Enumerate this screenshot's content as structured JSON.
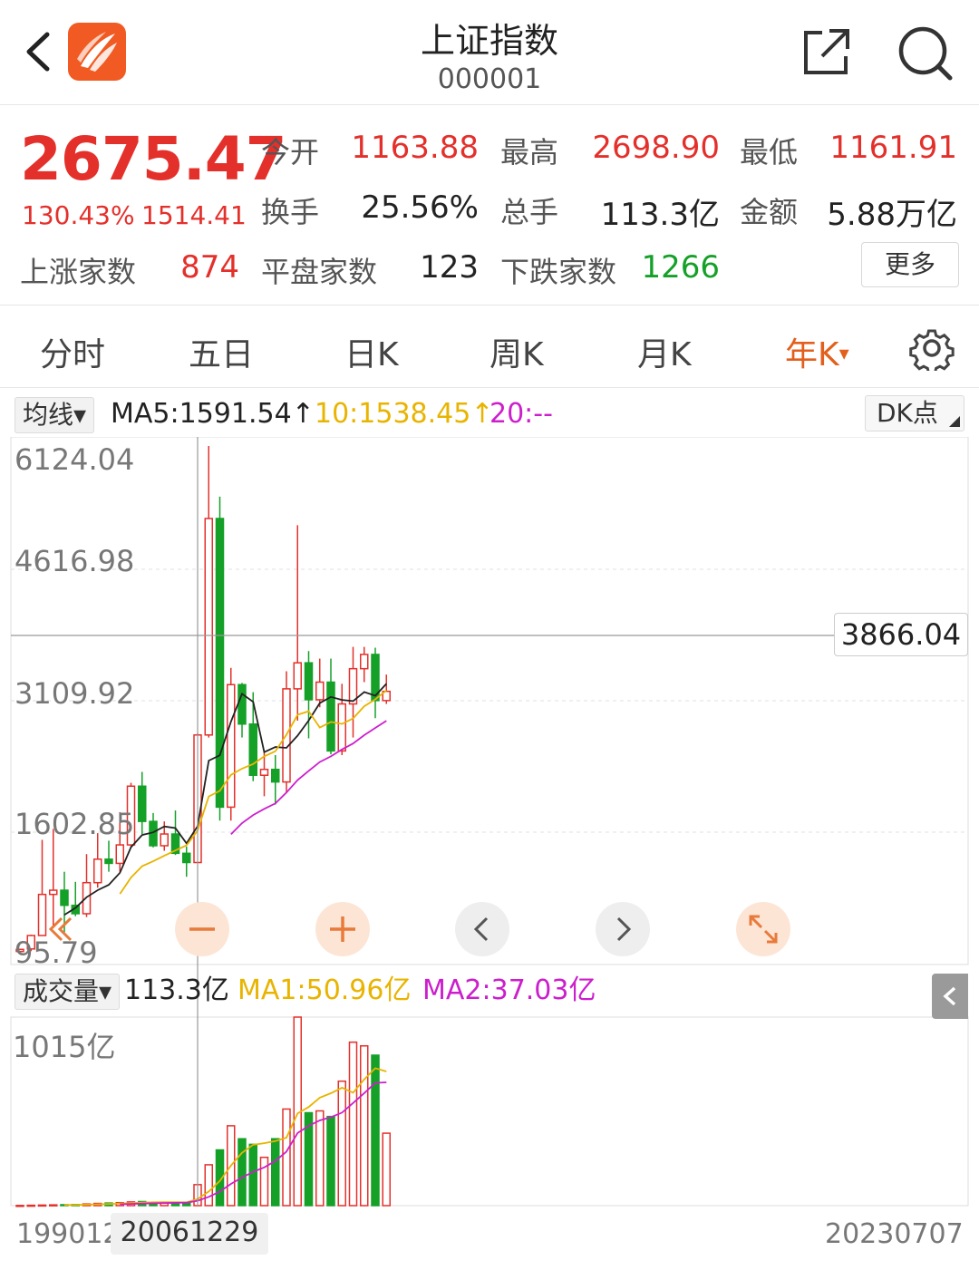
{
  "header": {
    "title": "上证指数",
    "code": "000001"
  },
  "quote": {
    "price": "2675.47",
    "pct": "130.43%",
    "chg": "1514.41",
    "open_label": "今开",
    "open": "1163.88",
    "high_label": "最高",
    "high": "2698.90",
    "low_label": "最低",
    "low": "1161.91",
    "turnover_label": "换手",
    "turnover": "25.56%",
    "volume_label": "总手",
    "volume": "113.3亿",
    "amount_label": "金额",
    "amount": "5.88万亿",
    "up_label": "上涨家数",
    "up": "874",
    "flat_label": "平盘家数",
    "flat": "123",
    "down_label": "下跌家数",
    "down": "1266",
    "more": "更多"
  },
  "tabs": [
    {
      "label": "分时"
    },
    {
      "label": "五日"
    },
    {
      "label": "日K"
    },
    {
      "label": "周K"
    },
    {
      "label": "月K"
    },
    {
      "label": "年K"
    }
  ],
  "active_tab_suffix": "▾",
  "ma": {
    "dropdown": "均线▾",
    "ma5": "MA5:1591.54↑",
    "ma10": "10:1538.45↑",
    "ma20": "20:--",
    "dk": "DK点"
  },
  "volume": {
    "dropdown": "成交量▾",
    "total": "113.3亿",
    "ma1": "MA1:50.96亿",
    "ma2": "MA2:37.03亿"
  },
  "colors": {
    "up": "#e4302b",
    "down": "#15a028",
    "ma5": "#222222",
    "ma10": "#e8b400",
    "ma20": "#cc1fcc",
    "accent": "#e35f1c"
  },
  "chart_data": {
    "type": "candlestick",
    "period": "yearly",
    "price_axis": {
      "ticks": [
        "6124.04",
        "4616.98",
        "3109.92",
        "1602.85",
        "95.79"
      ],
      "range": [
        95.79,
        6124.04
      ]
    },
    "crosshair_price": "3866.04",
    "volume_axis": {
      "max_label": "1015亿"
    },
    "x_labels": {
      "start": "199012",
      "cursor": "20061229",
      "end": "20230707"
    },
    "candles": [
      {
        "o": 100,
        "c": 125,
        "h": 128,
        "l": 96,
        "v": 1
      },
      {
        "o": 130,
        "c": 290,
        "h": 300,
        "l": 104,
        "v": 2
      },
      {
        "o": 290,
        "c": 780,
        "h": 1430,
        "l": 290,
        "v": 3
      },
      {
        "o": 780,
        "c": 830,
        "h": 1560,
        "l": 386,
        "v": 4
      },
      {
        "o": 830,
        "c": 650,
        "h": 1050,
        "l": 330,
        "v": 5
      },
      {
        "o": 650,
        "c": 550,
        "h": 930,
        "l": 520,
        "v": 6
      },
      {
        "o": 550,
        "c": 920,
        "h": 1260,
        "l": 510,
        "v": 9
      },
      {
        "o": 920,
        "c": 1200,
        "h": 1510,
        "l": 860,
        "v": 12
      },
      {
        "o": 1200,
        "c": 1150,
        "h": 1420,
        "l": 1050,
        "v": 14
      },
      {
        "o": 1150,
        "c": 1370,
        "h": 1760,
        "l": 1050,
        "v": 16
      },
      {
        "o": 1370,
        "c": 2070,
        "h": 2110,
        "l": 1340,
        "v": 20
      },
      {
        "o": 2070,
        "c": 1650,
        "h": 2240,
        "l": 1500,
        "v": 22
      },
      {
        "o": 1650,
        "c": 1360,
        "h": 1750,
        "l": 1340,
        "v": 18
      },
      {
        "o": 1360,
        "c": 1500,
        "h": 1650,
        "l": 1300,
        "v": 17
      },
      {
        "o": 1500,
        "c": 1270,
        "h": 1780,
        "l": 1250,
        "v": 16
      },
      {
        "o": 1270,
        "c": 1160,
        "h": 1350,
        "l": 990,
        "v": 15
      },
      {
        "o": 1160,
        "c": 2680,
        "h": 2700,
        "l": 1160,
        "v": 113
      },
      {
        "o": 2680,
        "c": 5260,
        "h": 6124,
        "l": 2650,
        "v": 220
      },
      {
        "o": 5260,
        "c": 1820,
        "h": 5520,
        "l": 1660,
        "v": 300
      },
      {
        "o": 1820,
        "c": 3280,
        "h": 3480,
        "l": 1660,
        "v": 430
      },
      {
        "o": 3280,
        "c": 2810,
        "h": 3300,
        "l": 2650,
        "v": 360
      },
      {
        "o": 2810,
        "c": 2200,
        "h": 3190,
        "l": 2130,
        "v": 330
      },
      {
        "o": 2200,
        "c": 2270,
        "h": 2480,
        "l": 1950,
        "v": 260
      },
      {
        "o": 2270,
        "c": 2120,
        "h": 2440,
        "l": 1850,
        "v": 360
      },
      {
        "o": 2120,
        "c": 3230,
        "h": 3440,
        "l": 1990,
        "v": 520
      },
      {
        "o": 3230,
        "c": 3540,
        "h": 5180,
        "l": 2850,
        "v": 1015
      },
      {
        "o": 3540,
        "c": 3100,
        "h": 3680,
        "l": 2640,
        "v": 500
      },
      {
        "o": 3100,
        "c": 3310,
        "h": 3590,
        "l": 3010,
        "v": 510
      },
      {
        "o": 3310,
        "c": 2490,
        "h": 3590,
        "l": 2450,
        "v": 480
      },
      {
        "o": 2490,
        "c": 3050,
        "h": 3290,
        "l": 2440,
        "v": 670
      },
      {
        "o": 3050,
        "c": 3470,
        "h": 3730,
        "l": 2650,
        "v": 880
      },
      {
        "o": 3470,
        "c": 3640,
        "h": 3730,
        "l": 3310,
        "v": 860
      },
      {
        "o": 3640,
        "c": 3090,
        "h": 3720,
        "l": 2880,
        "v": 810
      },
      {
        "o": 3090,
        "c": 3200,
        "h": 3400,
        "l": 3050,
        "v": 390
      }
    ],
    "ma5_x_values": true
  }
}
